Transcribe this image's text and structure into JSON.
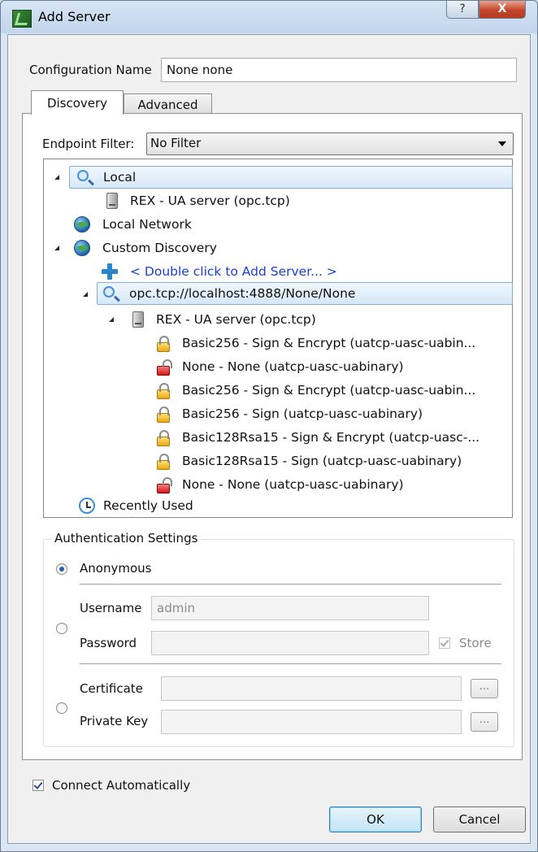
{
  "window": {
    "title": "Add Server",
    "help_label": "?",
    "close_label": "X"
  },
  "config": {
    "label": "Configuration Name",
    "value": "None none"
  },
  "tabs": [
    {
      "label": "Discovery",
      "active": true
    },
    {
      "label": "Advanced",
      "active": false
    }
  ],
  "endpoint_filter": {
    "label": "Endpoint Filter:",
    "value": "No Filter"
  },
  "tree": [
    {
      "label": "Local",
      "icon": "magnifier-icon",
      "expander": "open",
      "selected": true
    },
    {
      "label": "REX - UA server (opc.tcp)",
      "icon": "server-icon",
      "expander": "closed"
    },
    {
      "label": "Local Network",
      "icon": "globe-icon",
      "expander": "closed"
    },
    {
      "label": "Custom Discovery",
      "icon": "globe-icon",
      "expander": "open"
    },
    {
      "label": "< Double click to Add Server... >",
      "icon": "plus-icon",
      "expander": "none",
      "color": "#1a3fd6"
    },
    {
      "label": "opc.tcp://localhost:4888/None/None",
      "icon": "magnifier-icon",
      "expander": "open",
      "selected": true
    },
    {
      "label": "REX - UA server (opc.tcp)",
      "icon": "server-icon",
      "expander": "open"
    },
    {
      "label": "Basic256 - Sign & Encrypt (uatcp-uasc-uabin...",
      "icon": "lock-icon",
      "expander": "none"
    },
    {
      "label": "None - None (uatcp-uasc-uabinary)",
      "icon": "unlock-icon",
      "expander": "none"
    },
    {
      "label": "Basic256 - Sign & Encrypt (uatcp-uasc-uabin...",
      "icon": "lock-icon",
      "expander": "none"
    },
    {
      "label": "Basic256 - Sign (uatcp-uasc-uabinary)",
      "icon": "lock-icon",
      "expander": "none"
    },
    {
      "label": "Basic128Rsa15 - Sign & Encrypt (uatcp-uasc-...",
      "icon": "lock-icon",
      "expander": "none"
    },
    {
      "label": "Basic128Rsa15 - Sign (uatcp-uasc-uabinary)",
      "icon": "lock-icon",
      "expander": "none"
    },
    {
      "label": "None - None (uatcp-uasc-uabinary)",
      "icon": "unlock-icon",
      "expander": "none"
    },
    {
      "label": "Recently Used",
      "icon": "clock-icon",
      "expander": "closed"
    }
  ],
  "auth": {
    "title": "Authentication Settings",
    "anonymous_label": "Anonymous",
    "username_label": "Username",
    "username_value": "admin",
    "password_label": "Password",
    "password_value": "",
    "store_label": "Store",
    "certificate_label": "Certificate",
    "certificate_value": "",
    "private_key_label": "Private Key",
    "private_key_value": "",
    "browse_label": "..."
  },
  "connect_auto_label": "Connect Automatically",
  "buttons": {
    "ok": "OK",
    "cancel": "Cancel"
  },
  "colors": {
    "link_blue": "#1a3fd6",
    "selection_border": "#84acdd"
  }
}
